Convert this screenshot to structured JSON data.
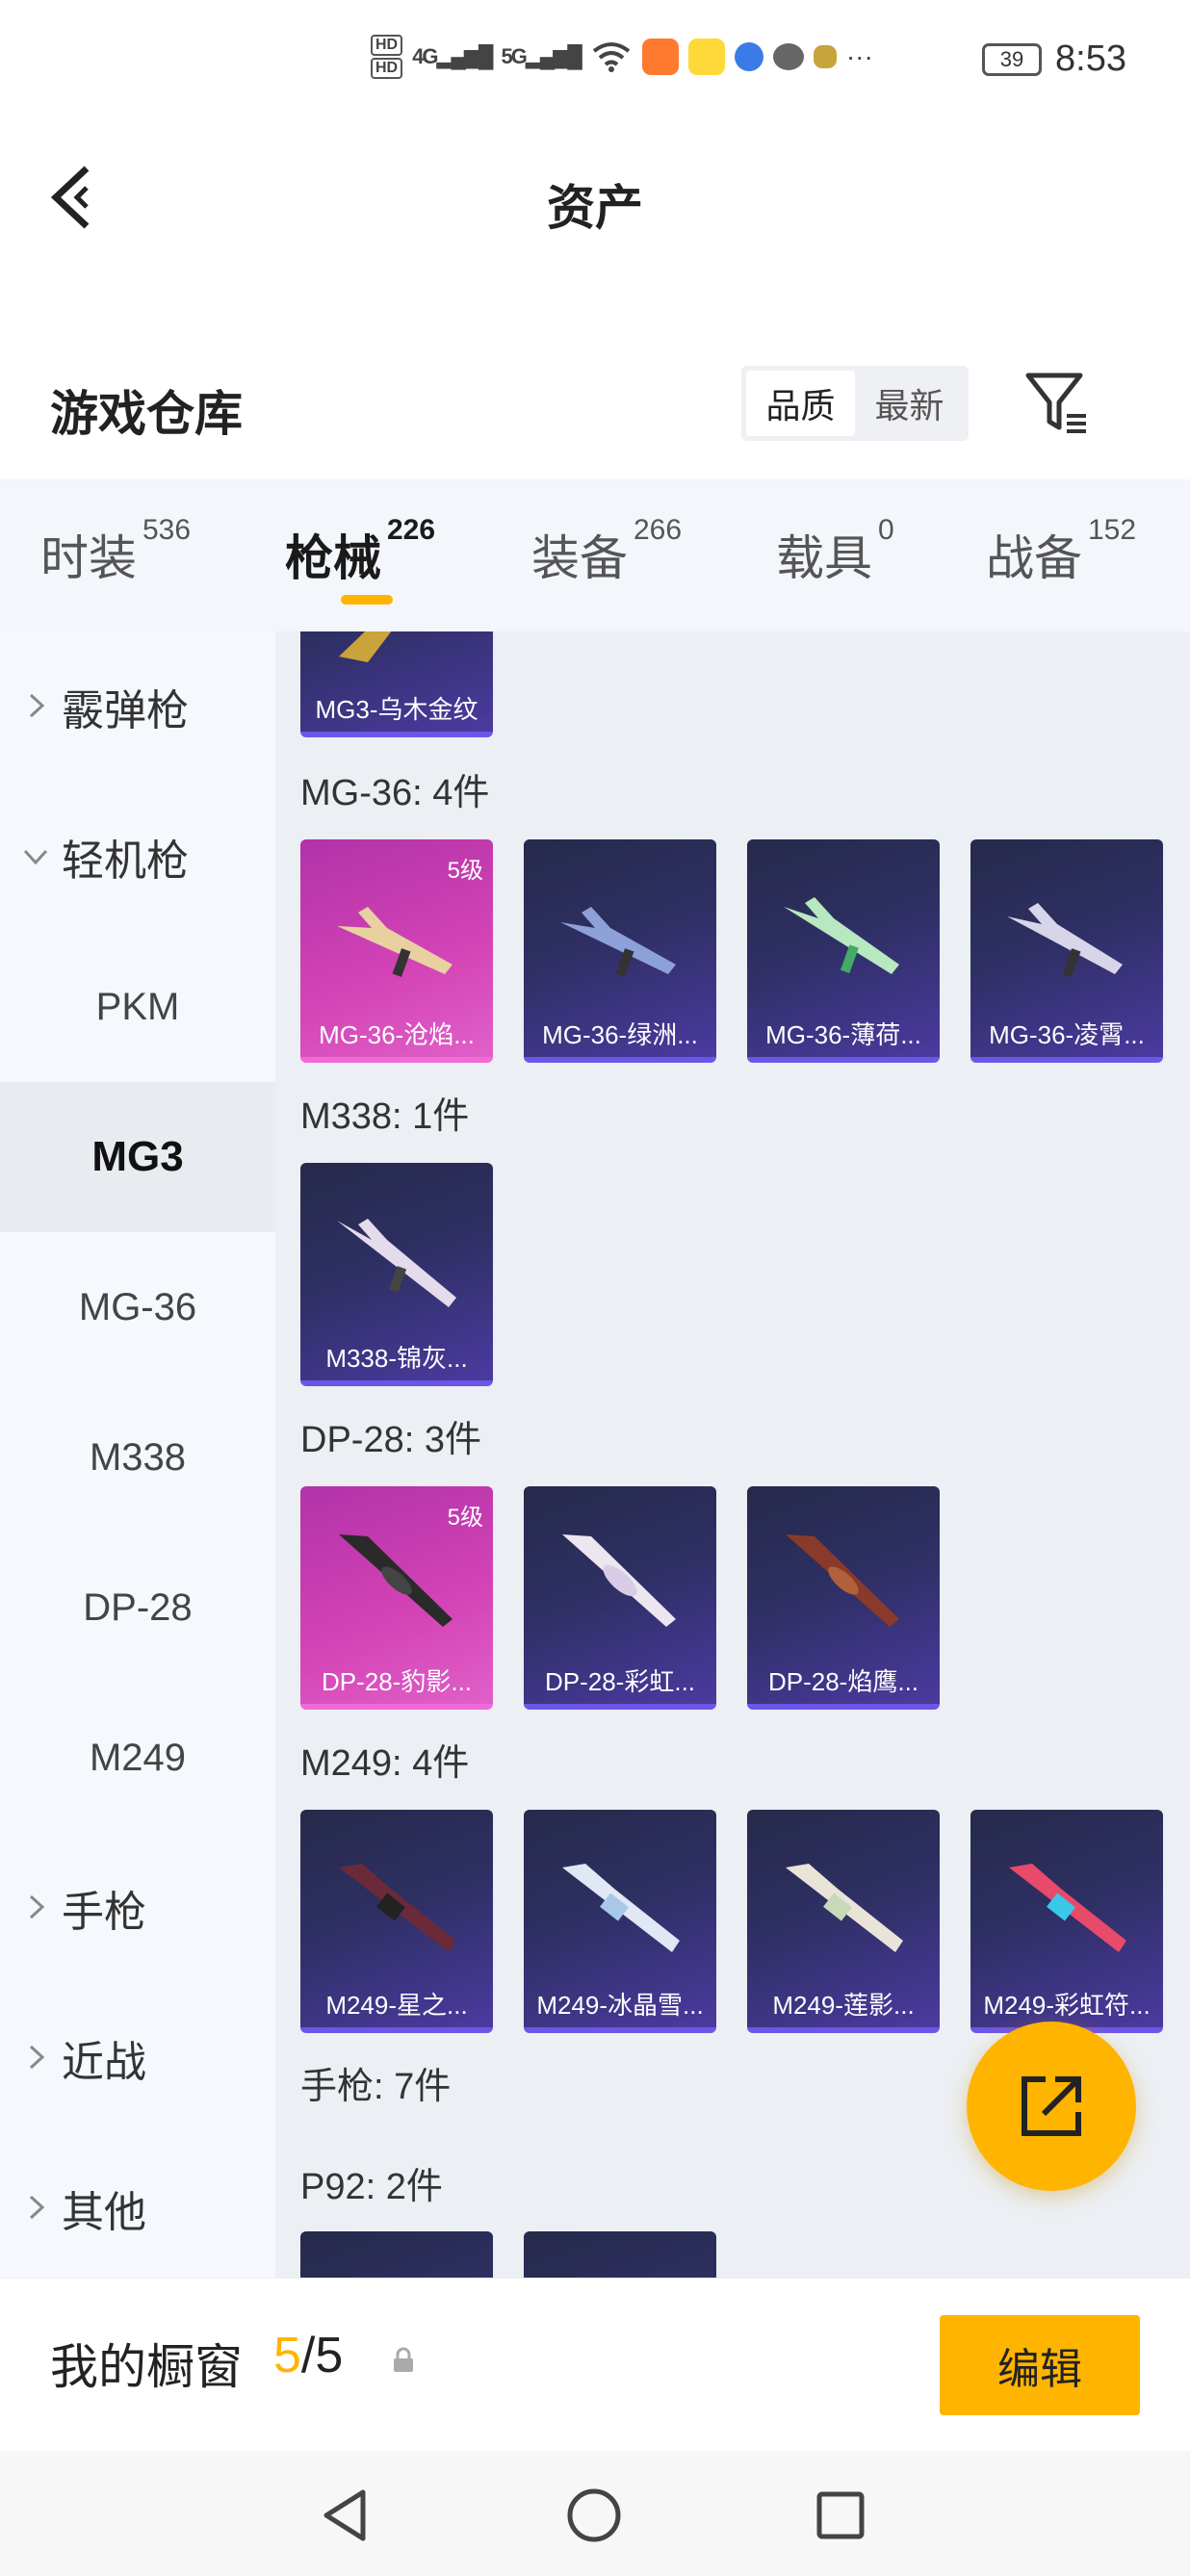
{
  "status_bar": {
    "hd1": "HD",
    "hd2": "HD",
    "sig1": "4G",
    "sig2": "5G",
    "more": "···",
    "battery": "39",
    "time": "8:53"
  },
  "header": {
    "title": "资产"
  },
  "warehouse": {
    "title": "游戏仓库",
    "sort_quality": "品质",
    "sort_newest": "最新"
  },
  "tabs": [
    {
      "label": "时装",
      "count": "536"
    },
    {
      "label": "枪械",
      "count": "226"
    },
    {
      "label": "装备",
      "count": "266"
    },
    {
      "label": "载具",
      "count": "0"
    },
    {
      "label": "战备",
      "count": "152"
    }
  ],
  "sidebar": {
    "items": [
      {
        "label": "霰弹枪"
      },
      {
        "label": "轻机枪"
      },
      {
        "label": "PKM"
      },
      {
        "label": "MG3"
      },
      {
        "label": "MG-36"
      },
      {
        "label": "M338"
      },
      {
        "label": "DP-28"
      },
      {
        "label": "M249"
      },
      {
        "label": "手枪"
      },
      {
        "label": "近战"
      },
      {
        "label": "其他"
      }
    ]
  },
  "content": {
    "top_card": "MG3-乌木金纹",
    "sections": [
      {
        "title": "MG-36: 4件",
        "cards": [
          {
            "name": "MG-36-沧焰...",
            "level": "5级"
          },
          {
            "name": "MG-36-绿洲..."
          },
          {
            "name": "MG-36-薄荷..."
          },
          {
            "name": "MG-36-凌霄..."
          }
        ]
      },
      {
        "title": "M338: 1件",
        "cards": [
          {
            "name": "M338-锦灰..."
          }
        ]
      },
      {
        "title": "DP-28: 3件",
        "cards": [
          {
            "name": "DP-28-豹影...",
            "level": "5级"
          },
          {
            "name": "DP-28-彩虹..."
          },
          {
            "name": "DP-28-焰鹰..."
          }
        ]
      },
      {
        "title": "M249: 4件",
        "cards": [
          {
            "name": "M249-星之..."
          },
          {
            "name": "M249-冰晶雪..."
          },
          {
            "name": "M249-莲影..."
          },
          {
            "name": "M249-彩虹符..."
          }
        ]
      }
    ],
    "pistol_title": "手枪: 7件",
    "p92_title": "P92: 2件"
  },
  "bottom_bar": {
    "label": "我的橱窗",
    "current": "5",
    "total": "/5",
    "edit": "编辑"
  },
  "colors": {
    "accent": "#ffb400",
    "card_normal": "#2e2f63",
    "card_legendary": "#d444b6"
  }
}
